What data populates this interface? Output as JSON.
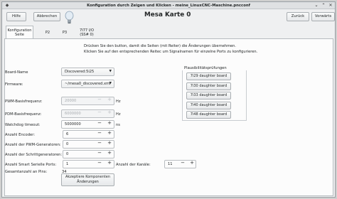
{
  "window": {
    "title": "Konfiguration durch Zeigen und Klicken - meine_LinuxCNC-Maschine.pncconf"
  },
  "toolbar": {
    "help_label": "Hilfe",
    "cancel_label": "Abbrechen",
    "back_label": "Zurück",
    "forward_label": "Vorwärts"
  },
  "header": {
    "title": "Mesa Karte 0"
  },
  "tabs": [
    {
      "label": "Konfiguration\nSeite",
      "active": true
    },
    {
      "label": "P2"
    },
    {
      "label": "P3"
    },
    {
      "label": "7I77 I/O\n(SS# 0)"
    }
  ],
  "instructions": {
    "line1": "Drücken Sie den button, damit die Seiten (mit Reiter) die Änderungen übernehmen.",
    "line2": "Klicken Sie auf den entsprechenden Reitec um Signalnamen für einzelne Ports zu konfigurieren."
  },
  "form": {
    "board_name": {
      "label": "Board-Name",
      "value": "Discovered:5i25"
    },
    "firmware": {
      "label": "Firmware:",
      "value": "~/mesa0_discovered.xml"
    },
    "pwm_base": {
      "label": "PWM-Basisfrequenz:",
      "value": "20000",
      "unit": "Hz"
    },
    "pdm_base": {
      "label": "PDM-Basisfrequenz:",
      "value": "6000000",
      "unit": "Hz"
    },
    "watchdog": {
      "label": "Watchdog timeout:",
      "value": "5000000",
      "unit": "ns"
    },
    "encoders": {
      "label": "Anzahl Encoder:",
      "value": "6"
    },
    "pwm_gens": {
      "label": "Anzahl der PWM-Generatoren:",
      "value": "0"
    },
    "step_gens": {
      "label": "Anzahl der Schrittgeneratoren:",
      "value": "0"
    },
    "smart_serial": {
      "label": "Anzahl Smart Serielle Ports:",
      "value": "1"
    },
    "channels": {
      "label": "Anzahl der Kanäle:",
      "value": "11"
    },
    "total_pins": {
      "label": "Gesamtanzahl an Pins:",
      "value": "34"
    },
    "accept_label": "Akzeptiere  Komponenten\nÄnderungen"
  },
  "plausibility": {
    "title": "Plausibilitätsprüfungen",
    "buttons": [
      "7i29 daughter board",
      "7i30 daughter board",
      "7i33 daughter board",
      "7i40 daughter board",
      "7i48 daughter board"
    ]
  },
  "colors": {
    "accent": "#3daee9",
    "window_bg": "#eff0f1",
    "panel_bg": "#fcfcfc"
  }
}
